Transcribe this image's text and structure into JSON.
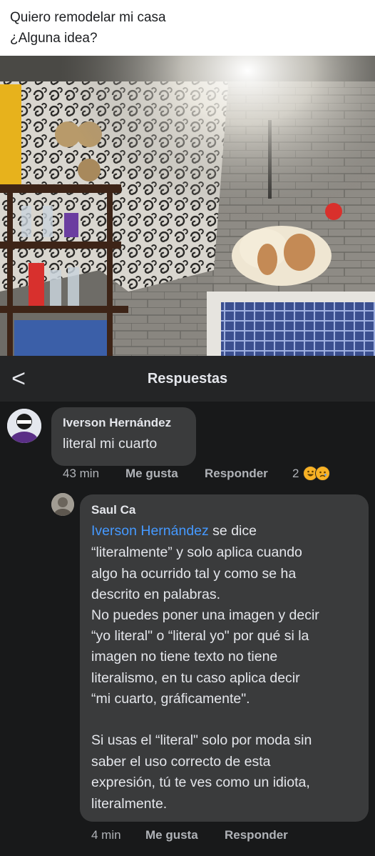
{
  "post": {
    "line1": "Quiero remodelar mi casa",
    "line2": "¿Alguna idea?"
  },
  "nav": {
    "title": "Respuestas",
    "back": "<"
  },
  "comment1": {
    "author": "Iverson Hernández",
    "text": "literal mi cuarto",
    "time": "43 min",
    "like": "Me gusta",
    "reply": "Responder",
    "reaction_count": "2",
    "reaction_icons": [
      "haha-icon",
      "sad-icon"
    ]
  },
  "comment2": {
    "author": "Saul Ca",
    "mention": "Iverson Hernández",
    "lines": [
      " se dice",
      "“literalmente” y solo aplica cuando",
      "algo ha ocurrido tal y como se ha",
      "descrito en palabras.",
      "No puedes poner una imagen y decir",
      "“yo literal\" o “literal yo\" por qué si la",
      "imagen no tiene texto no tiene",
      "literalismo, en tu caso aplica decir",
      "“mi cuarto, gráficamente\".",
      "",
      "Si usas el “literal\" solo por moda sin",
      "saber el uso correcto de esta",
      "expresión, tú te ves como un idiota,",
      "literalmente."
    ],
    "time": "4 min",
    "like": "Me gusta",
    "reply": "Responder"
  },
  "colors": {
    "bg": "#18191a",
    "bubble": "#3a3b3c",
    "mention": "#4599ff",
    "meta": "#b0b3b8"
  }
}
